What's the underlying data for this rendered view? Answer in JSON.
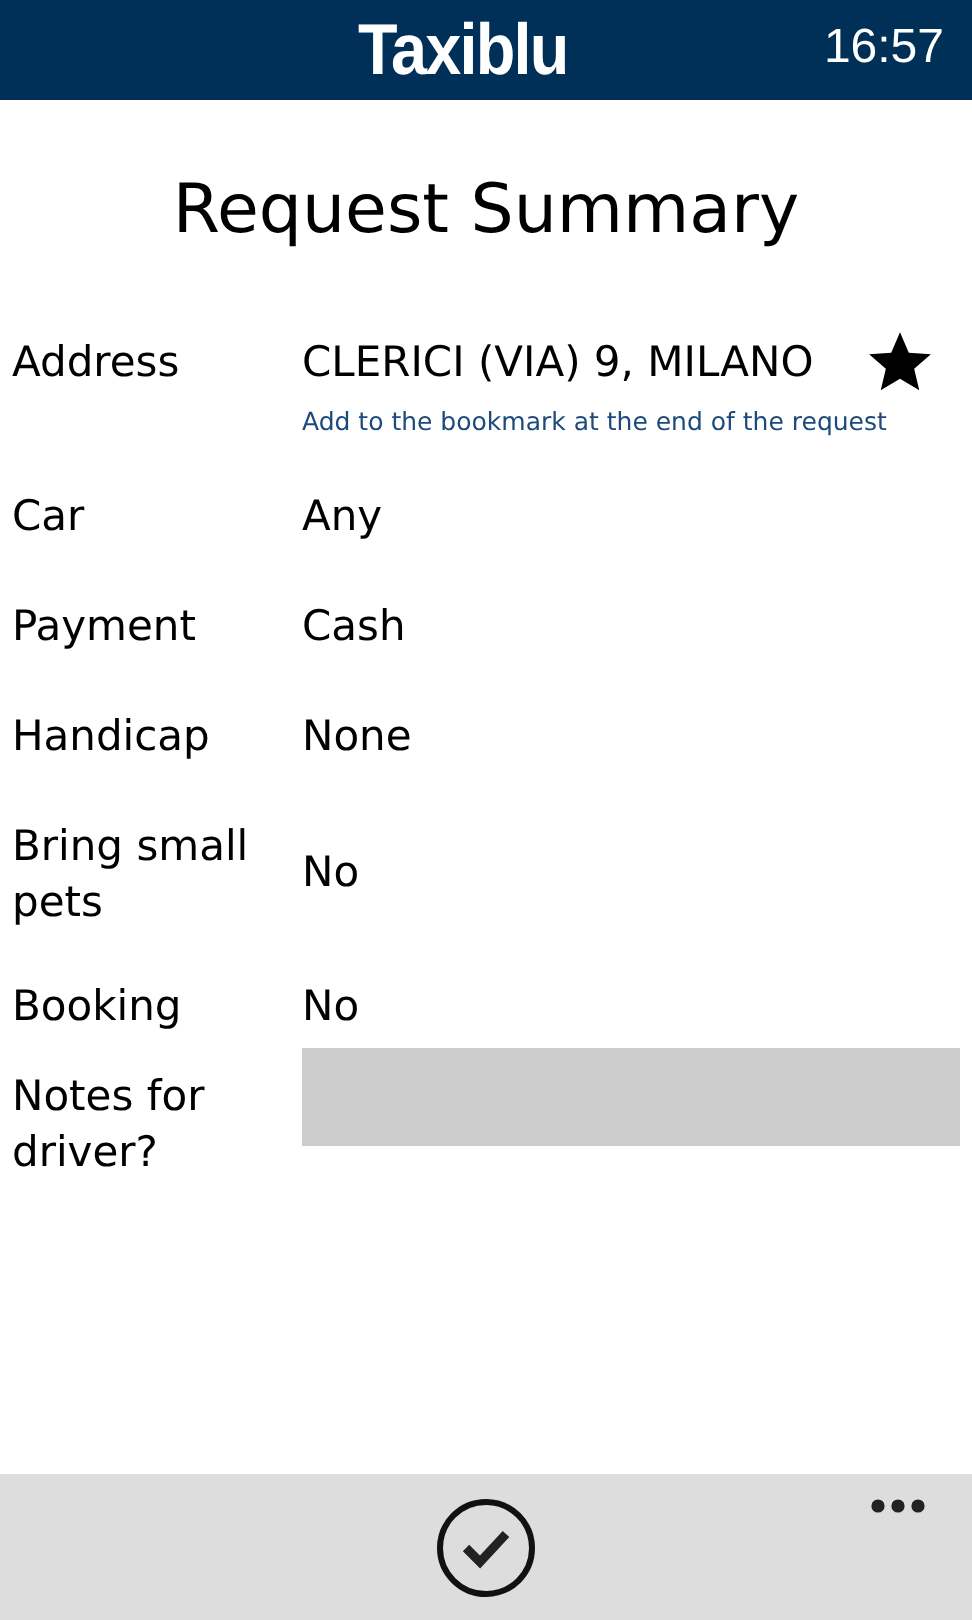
{
  "header": {
    "logo": "Taxiblu",
    "time": "16:57"
  },
  "title": "Request Summary",
  "rows": [
    {
      "kind": "address",
      "label": "Address",
      "value": "CLERICI (VIA) 9, MILANO",
      "hint": "Add to the bookmark at the end of the request"
    },
    {
      "kind": "text",
      "label": "Car",
      "value": "Any"
    },
    {
      "kind": "text",
      "label": "Payment",
      "value": "Cash"
    },
    {
      "kind": "text",
      "label": "Handicap",
      "value": "None"
    },
    {
      "kind": "text",
      "label": "Bring small pets",
      "value": "No"
    },
    {
      "kind": "text",
      "label": "Booking",
      "value": "No"
    },
    {
      "kind": "field",
      "label": "Notes for driver?"
    }
  ]
}
